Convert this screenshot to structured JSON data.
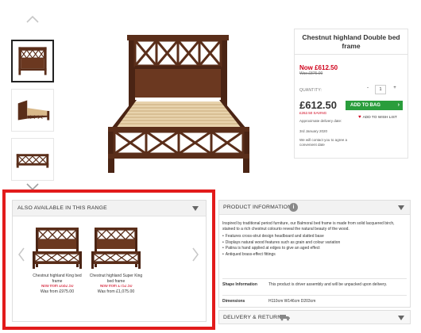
{
  "product": {
    "title": "Chestnut highland Double bed frame",
    "now_price": "Now £612.50",
    "was_price": "Was £875.00",
    "quantity_label": "QUANTITY:",
    "quantity_minus": "-",
    "quantity_value": "1",
    "quantity_plus": "+",
    "price": "£612.50",
    "saving": "£262.50 SAVING",
    "add_to_bag": "ADD TO BAG",
    "add_to_bag_arrow": "›",
    "wishlist": "ADD TO WISH LIST",
    "approx_delivery_label": "Approximate delivery date:",
    "delivery_date": "3rd January 2020",
    "contact_note": "We will contact you to agree a convenient date"
  },
  "range": {
    "title": "ALSO AVAILABLE IN THIS RANGE",
    "items": [
      {
        "name": "Chestnut highland King bed frame",
        "now": "Now from £682.50",
        "was": "Was from £975.00"
      },
      {
        "name": "Chestnut highland Super King bed frame",
        "now": "Now from £752.50",
        "was": "Was from £1,075.00"
      }
    ]
  },
  "info": {
    "title": "PRODUCT INFORMATION",
    "icon_glyph": "i",
    "description": "Inspired by traditional period furniture, our Balmoral bed frame is made from solid lacquered birch, stained to a rich chestnut colourto reveal the natural beauty of the wood.",
    "features": [
      "Features cross-strut design headboard and slatted base",
      "Displays natural wood features such as grain and colour variation",
      "Patina is hand applied at edges to give an aged effect",
      "Antiqued brass-effect fittings"
    ],
    "specs": [
      {
        "label": "Shape Information",
        "value": "This product is driver assembly and will be unpacked upon delivery."
      },
      {
        "label": "Dimensions",
        "value": "H110cm W146cm D203cm"
      }
    ]
  },
  "delivery": {
    "title": "DELIVERY & RETURNS"
  },
  "colors": {
    "accent_red": "#d0021b",
    "highlight_outline": "#e21b1b",
    "add_to_bag_green": "#2a9d3c",
    "wood": "#5a2e1a"
  },
  "icons": {
    "thumb_up": "chevron-up-icon",
    "thumb_down": "chevron-down-icon",
    "info": "info-icon",
    "truck": "truck-icon",
    "heart": "heart-icon"
  }
}
